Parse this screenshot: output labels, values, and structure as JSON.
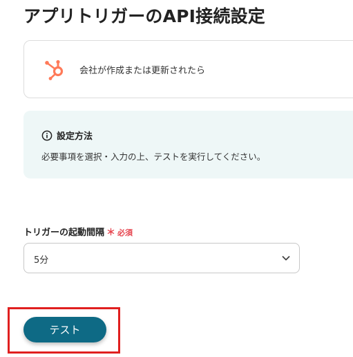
{
  "header": {
    "title": "アプリトリガーのAPI接続設定"
  },
  "app_card": {
    "icon": "hubspot-icon",
    "icon_color": "#ff7a59",
    "label": "会社が作成または更新されたら"
  },
  "info": {
    "icon": "info-circle-icon",
    "title": "設定方法",
    "description": "必要事項を選択・入力の上、テストを実行してください。",
    "background_color": "#eef7f7"
  },
  "trigger_interval": {
    "label": "トリガーの起動間隔",
    "required_mark": "＊",
    "required_text": "必須",
    "value": "5分",
    "required_color": "#e6454f"
  },
  "actions": {
    "test_label": "テスト",
    "button_color": "#0e6a85",
    "highlight_color": "#e01f1f"
  }
}
